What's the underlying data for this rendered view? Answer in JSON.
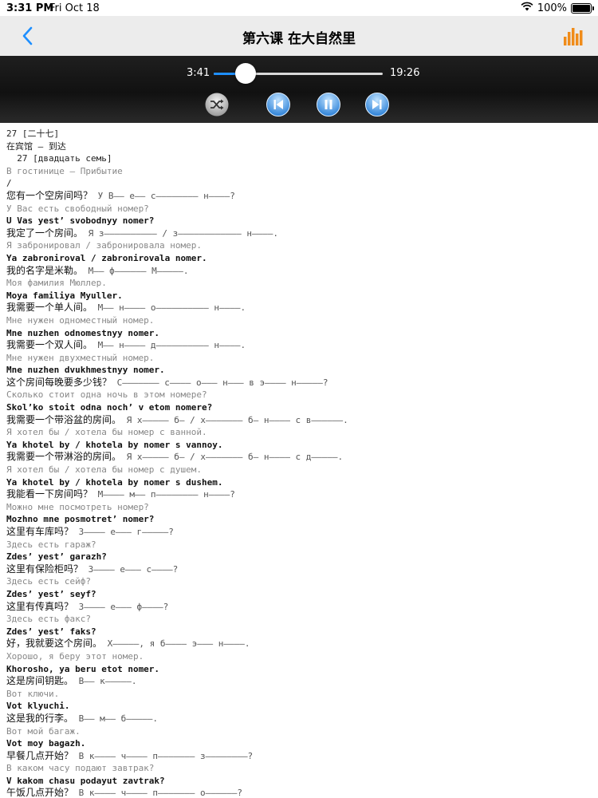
{
  "status": {
    "time": "3:31 PM",
    "date": "Fri Oct 18",
    "battery": "100%",
    "battery_level": 1.0
  },
  "nav": {
    "title": "第六课 在大自然里"
  },
  "player": {
    "elapsed": "3:41",
    "duration": "19:26",
    "progress": 0.19
  },
  "colors": {
    "accent": "#1e8fff",
    "icon_orange": "#f08c1a"
  },
  "icons": {
    "back": "chevron-left-icon",
    "menu": "bar-chart-icon",
    "shuffle": "shuffle-icon",
    "prev": "skip-previous-icon",
    "pause": "pause-icon",
    "next": "skip-next-icon"
  },
  "content": {
    "lines": [
      {
        "type": "header",
        "text": "27 [二十七]"
      },
      {
        "type": "header",
        "text": "在宾馆 – 到达"
      },
      {
        "type": "header",
        "text": "  27 [двадцать семь]"
      },
      {
        "type": "ru",
        "text": "В гостинице – Прибытие"
      },
      {
        "type": "header",
        "text": "/"
      },
      {
        "type": "zh",
        "zh": "您有一个空房间吗？",
        "hint": " У В—— е—— с———————— н————?"
      },
      {
        "type": "ru",
        "text": "У Вас есть свободный номер?"
      },
      {
        "type": "tr",
        "text": "U Vas yest’ svobodnyy nomer?"
      },
      {
        "type": "zh",
        "zh": "我定了一个房间。",
        "hint": " Я з—————————— / з———————————— н————."
      },
      {
        "type": "ru",
        "text": "Я забронировал / забронировала номер."
      },
      {
        "type": "tr",
        "text": "Ya zabroniroval / zabronirovala nomer."
      },
      {
        "type": "zh",
        "zh": "我的名字是米勒。",
        "hint": " М—— ф—————— М—————."
      },
      {
        "type": "ru",
        "text": "Моя фамилия Мюллер."
      },
      {
        "type": "tr",
        "text": "Moya familiya Myuller."
      },
      {
        "type": "zh",
        "zh": "我需要一个单人间。",
        "hint": " М—— н———— о—————————— н————."
      },
      {
        "type": "ru",
        "text": "Мне нужен одноместный номер."
      },
      {
        "type": "tr",
        "text": "Mne nuzhen odnomestnyy nomer."
      },
      {
        "type": "zh",
        "zh": "我需要一个双人间。",
        "hint": " М—— н———— д—————————— н————."
      },
      {
        "type": "ru",
        "text": "Мне нужен двухместный номер."
      },
      {
        "type": "tr",
        "text": "Mne nuzhen dvukhmestnyy nomer."
      },
      {
        "type": "zh",
        "zh": "这个房间每晚要多少钱？",
        "hint": " С——————— с———— о——— н——— в э———— н—————?"
      },
      {
        "type": "ru",
        "text": "Сколько стоит одна ночь в этом номере?"
      },
      {
        "type": "tr",
        "text": "Skol’ko stoit odna noch’ v etom nomere?"
      },
      {
        "type": "zh",
        "zh": "我需要一个带浴盆的房间。",
        "hint": " Я х————— б— / х——————— б— н———— с в——————."
      },
      {
        "type": "ru",
        "text": "Я хотел бы / хотела бы номер с ванной."
      },
      {
        "type": "tr",
        "text": "Ya khotel by / khotela by nomer s vannoy."
      },
      {
        "type": "zh",
        "zh": "我需要一个带淋浴的房间。",
        "hint": " Я х————— б— / х——————— б— н———— с д—————."
      },
      {
        "type": "ru",
        "text": "Я хотел бы / хотела бы номер с душем."
      },
      {
        "type": "tr",
        "text": "Ya khotel by / khotela by nomer s dushem."
      },
      {
        "type": "zh",
        "zh": "我能看一下房间吗？",
        "hint": " М———— м—— п———————— н————?"
      },
      {
        "type": "ru",
        "text": "Можно мне посмотреть номер?"
      },
      {
        "type": "tr",
        "text": "Mozhno mne posmotret’ nomer?"
      },
      {
        "type": "zh",
        "zh": "这里有车库吗？",
        "hint": " З———— е——— г—————?"
      },
      {
        "type": "ru",
        "text": "Здесь есть гараж?"
      },
      {
        "type": "tr",
        "text": "Zdes’ yest’ garazh?"
      },
      {
        "type": "zh",
        "zh": "这里有保险柜吗？",
        "hint": " З———— е——— с————?"
      },
      {
        "type": "ru",
        "text": "Здесь есть сейф?"
      },
      {
        "type": "tr",
        "text": "Zdes’ yest’ seyf?"
      },
      {
        "type": "zh",
        "zh": "这里有传真吗？",
        "hint": " З———— е——— ф————?"
      },
      {
        "type": "ru",
        "text": "Здесь есть факс?"
      },
      {
        "type": "tr",
        "text": "Zdes’ yest’ faks?"
      },
      {
        "type": "zh",
        "zh": "好，我就要这个房间。",
        "hint": " Х—————, я б———— э——— н————."
      },
      {
        "type": "ru",
        "text": "Хорошо, я беру этот номер."
      },
      {
        "type": "tr",
        "text": "Khorosho, ya beru etot nomer."
      },
      {
        "type": "zh",
        "zh": "这是房间钥匙。",
        "hint": " В—— к—————."
      },
      {
        "type": "ru",
        "text": "Вот ключи."
      },
      {
        "type": "tr",
        "text": "Vot klyuchi."
      },
      {
        "type": "zh",
        "zh": "这是我的行李。",
        "hint": " В—— м—— б—————."
      },
      {
        "type": "ru",
        "text": "Вот мой багаж."
      },
      {
        "type": "tr",
        "text": "Vot moy bagazh."
      },
      {
        "type": "zh",
        "zh": "早餐几点开始？",
        "hint": " В к———— ч———— п——————— з————————?"
      },
      {
        "type": "ru",
        "text": "В каком часу подают завтрак?"
      },
      {
        "type": "tr",
        "text": "V kakom chasu podayut zavtrak?"
      },
      {
        "type": "zh",
        "zh": "午饭几点开始？",
        "hint": " В к———— ч———— п——————— о——————?"
      }
    ]
  }
}
